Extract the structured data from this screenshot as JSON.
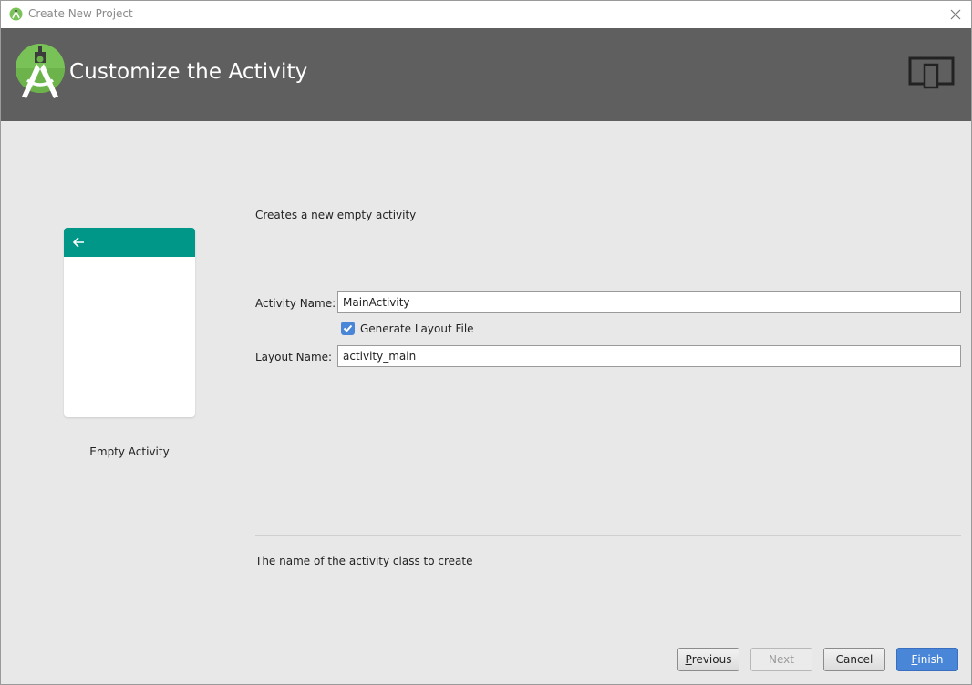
{
  "window": {
    "title": "Create New Project",
    "icons": {
      "app": "android-studio-icon",
      "close": "close-icon"
    }
  },
  "header": {
    "title": "Customize the Activity",
    "logo": "android-studio-logo",
    "device_icon": "device-form-factor-icon"
  },
  "preview": {
    "template_label": "Empty Activity",
    "appbar_color": "#009688",
    "back_icon": "arrow-left-icon"
  },
  "form": {
    "description": "Creates a new empty activity",
    "activity_name": {
      "label": "Activity Name:",
      "value": "MainActivity"
    },
    "generate_layout": {
      "label": "Generate Layout File",
      "checked": true
    },
    "layout_name": {
      "label": "Layout Name:",
      "value": "activity_main"
    },
    "help_text": "The name of the activity class to create"
  },
  "buttons": {
    "previous": {
      "mnemonic": "P",
      "rest": "revious",
      "enabled": true
    },
    "next": {
      "label": "Next",
      "enabled": false
    },
    "cancel": {
      "label": "Cancel",
      "enabled": true
    },
    "finish": {
      "mnemonic": "F",
      "rest": "inish",
      "enabled": true,
      "color": "#4a86d8"
    }
  }
}
